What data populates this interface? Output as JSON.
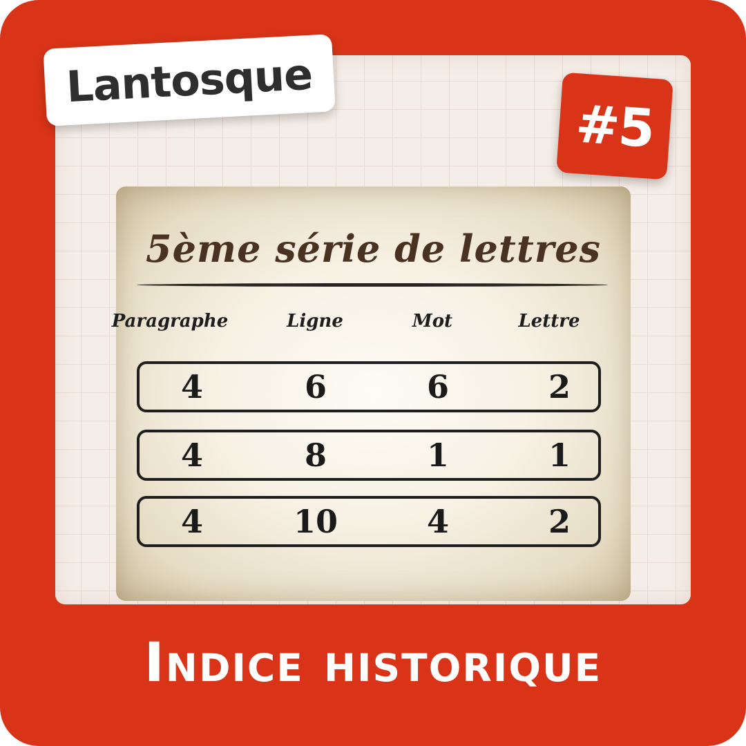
{
  "brand": "Lantosque",
  "badge": "#5",
  "card": {
    "title": "5ème série de lettres",
    "columns": [
      "Paragraphe",
      "Ligne",
      "Mot",
      "Lettre"
    ],
    "rows": [
      [
        "4",
        "6",
        "6",
        "2"
      ],
      [
        "4",
        "8",
        "1",
        "1"
      ],
      [
        "4",
        "10",
        "4",
        "2"
      ]
    ]
  },
  "footer": "Indice historique",
  "colors": {
    "frame": "#d93417",
    "panel": "#f5ede7",
    "ink": "#1e1e1e",
    "title_ink": "#4a3222"
  }
}
